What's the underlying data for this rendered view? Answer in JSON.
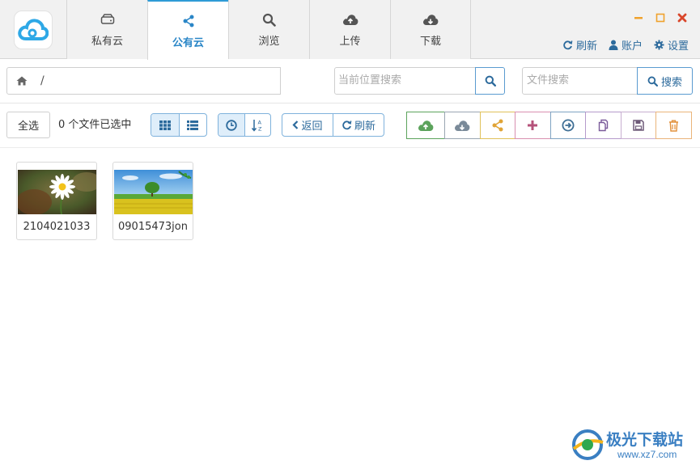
{
  "tabs": [
    {
      "label": "私有云",
      "icon": "hard-drive-icon"
    },
    {
      "label": "公有云",
      "icon": "share-icon",
      "active": true
    },
    {
      "label": "浏览",
      "icon": "search-icon"
    },
    {
      "label": "上传",
      "icon": "cloud-upload-icon"
    },
    {
      "label": "下载",
      "icon": "cloud-download-icon"
    }
  ],
  "user_menu": {
    "refresh": "刷新",
    "account": "账户",
    "settings": "设置"
  },
  "path": {
    "value": "/"
  },
  "location_search": {
    "placeholder": "当前位置搜索"
  },
  "file_search": {
    "placeholder": "文件搜索",
    "button_label": "搜索"
  },
  "toolbar": {
    "select_all": "全选",
    "selection_status": "0 个文件已选中",
    "back": "返回",
    "refresh": "刷新"
  },
  "actions": [
    {
      "name": "upload-action-button",
      "icon": "cloud-upload-icon",
      "color": "#5ca35c"
    },
    {
      "name": "download-action-button",
      "icon": "cloud-download-icon",
      "color": "#7a8a99"
    },
    {
      "name": "share-action-button",
      "icon": "share-icon",
      "color": "#e0a437"
    },
    {
      "name": "add-action-button",
      "icon": "plus-icon",
      "color": "#b5527a"
    },
    {
      "name": "move-action-button",
      "icon": "arrow-circle-right-icon",
      "color": "#3f6f95"
    },
    {
      "name": "copy-action-button",
      "icon": "copy-icon",
      "color": "#7a5a9a"
    },
    {
      "name": "save-action-button",
      "icon": "save-icon",
      "color": "#8e6f96"
    },
    {
      "name": "delete-action-button",
      "icon": "trash-icon",
      "color": "#e2903a"
    }
  ],
  "files": [
    {
      "name": "2104021033",
      "thumbnail": "daisy-flower"
    },
    {
      "name": "09015473jon",
      "thumbnail": "tree-field-landscape"
    }
  ],
  "watermark": {
    "text": "极光下载站",
    "url": "www.xz7.com"
  }
}
